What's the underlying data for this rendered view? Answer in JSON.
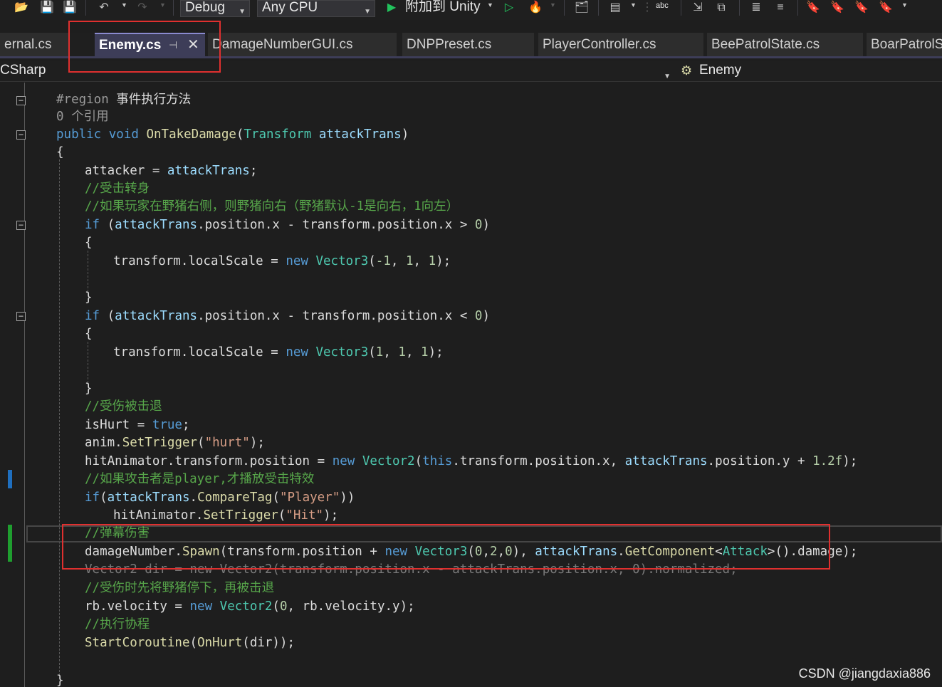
{
  "toolbar": {
    "config_value": "Debug",
    "platform_value": "Any CPU",
    "attach_label": "附加到 Unity",
    "spell_label": "abc"
  },
  "tabs": [
    {
      "label": "ernal.cs"
    },
    {
      "label": "Enemy.cs",
      "active": true
    },
    {
      "label": "DamageNumberGUI.cs"
    },
    {
      "label": "DNPPreset.cs"
    },
    {
      "label": "PlayerController.cs"
    },
    {
      "label": "BeePatrolState.cs"
    },
    {
      "label": "BoarPatrolS"
    }
  ],
  "navbar": {
    "project": "CSharp",
    "type_member": "Enemy"
  },
  "code": {
    "lines": [
      {
        "indent": 0,
        "tokens": [
          {
            "t": "#region",
            "c": "pp"
          },
          {
            "t": " 事件执行方法",
            "c": "plain"
          }
        ]
      },
      {
        "indent": 0,
        "tokens": [
          {
            "t": "0 个引用",
            "c": "ref"
          }
        ]
      },
      {
        "indent": 0,
        "tokens": [
          {
            "t": "public",
            "c": "kw"
          },
          {
            "t": " ",
            "c": "plain"
          },
          {
            "t": "void",
            "c": "kw"
          },
          {
            "t": " ",
            "c": "plain"
          },
          {
            "t": "OnTakeDamage",
            "c": "method"
          },
          {
            "t": "(",
            "c": "plain"
          },
          {
            "t": "Transform",
            "c": "type"
          },
          {
            "t": " ",
            "c": "plain"
          },
          {
            "t": "attackTrans",
            "c": "var"
          },
          {
            "t": ")",
            "c": "plain"
          }
        ]
      },
      {
        "indent": 0,
        "tokens": [
          {
            "t": "{",
            "c": "plain"
          }
        ]
      },
      {
        "indent": 1,
        "tokens": [
          {
            "t": "attacker",
            "c": "plain"
          },
          {
            "t": " = ",
            "c": "plain"
          },
          {
            "t": "attackTrans",
            "c": "var"
          },
          {
            "t": ";",
            "c": "plain"
          }
        ]
      },
      {
        "indent": 1,
        "tokens": [
          {
            "t": "//受击转身",
            "c": "cmt"
          }
        ]
      },
      {
        "indent": 1,
        "tokens": [
          {
            "t": "//如果玩家在野猪右侧，则野猪向右（野猪默认-1是向右，1向左）",
            "c": "cmt"
          }
        ]
      },
      {
        "indent": 1,
        "tokens": [
          {
            "t": "if",
            "c": "kw"
          },
          {
            "t": " (",
            "c": "plain"
          },
          {
            "t": "attackTrans",
            "c": "var"
          },
          {
            "t": ".position.x - transform.position.x > ",
            "c": "plain"
          },
          {
            "t": "0",
            "c": "num"
          },
          {
            "t": ")",
            "c": "plain"
          }
        ]
      },
      {
        "indent": 1,
        "tokens": [
          {
            "t": "{",
            "c": "plain"
          }
        ]
      },
      {
        "indent": 2,
        "tokens": [
          {
            "t": "transform.localScale = ",
            "c": "plain"
          },
          {
            "t": "new",
            "c": "kw"
          },
          {
            "t": " ",
            "c": "plain"
          },
          {
            "t": "Vector3",
            "c": "type"
          },
          {
            "t": "(",
            "c": "plain"
          },
          {
            "t": "-1",
            "c": "num"
          },
          {
            "t": ", ",
            "c": "plain"
          },
          {
            "t": "1",
            "c": "num"
          },
          {
            "t": ", ",
            "c": "plain"
          },
          {
            "t": "1",
            "c": "num"
          },
          {
            "t": ");",
            "c": "plain"
          }
        ]
      },
      {
        "indent": 2,
        "tokens": []
      },
      {
        "indent": 1,
        "tokens": [
          {
            "t": "}",
            "c": "plain"
          }
        ]
      },
      {
        "indent": 1,
        "tokens": [
          {
            "t": "if",
            "c": "kw"
          },
          {
            "t": " (",
            "c": "plain"
          },
          {
            "t": "attackTrans",
            "c": "var"
          },
          {
            "t": ".position.x - transform.position.x < ",
            "c": "plain"
          },
          {
            "t": "0",
            "c": "num"
          },
          {
            "t": ")",
            "c": "plain"
          }
        ]
      },
      {
        "indent": 1,
        "tokens": [
          {
            "t": "{",
            "c": "plain"
          }
        ]
      },
      {
        "indent": 2,
        "tokens": [
          {
            "t": "transform.localScale = ",
            "c": "plain"
          },
          {
            "t": "new",
            "c": "kw"
          },
          {
            "t": " ",
            "c": "plain"
          },
          {
            "t": "Vector3",
            "c": "type"
          },
          {
            "t": "(",
            "c": "plain"
          },
          {
            "t": "1",
            "c": "num"
          },
          {
            "t": ", ",
            "c": "plain"
          },
          {
            "t": "1",
            "c": "num"
          },
          {
            "t": ", ",
            "c": "plain"
          },
          {
            "t": "1",
            "c": "num"
          },
          {
            "t": ");",
            "c": "plain"
          }
        ]
      },
      {
        "indent": 2,
        "tokens": []
      },
      {
        "indent": 1,
        "tokens": [
          {
            "t": "}",
            "c": "plain"
          }
        ]
      },
      {
        "indent": 1,
        "tokens": [
          {
            "t": "//受伤被击退",
            "c": "cmt"
          }
        ]
      },
      {
        "indent": 1,
        "tokens": [
          {
            "t": "isHurt = ",
            "c": "plain"
          },
          {
            "t": "true",
            "c": "kw"
          },
          {
            "t": ";",
            "c": "plain"
          }
        ]
      },
      {
        "indent": 1,
        "tokens": [
          {
            "t": "anim.",
            "c": "plain"
          },
          {
            "t": "SetTrigger",
            "c": "method"
          },
          {
            "t": "(",
            "c": "plain"
          },
          {
            "t": "\"hurt\"",
            "c": "str"
          },
          {
            "t": ");",
            "c": "plain"
          }
        ]
      },
      {
        "indent": 1,
        "tokens": [
          {
            "t": "hitAnimator.transform.position = ",
            "c": "plain"
          },
          {
            "t": "new",
            "c": "kw"
          },
          {
            "t": " ",
            "c": "plain"
          },
          {
            "t": "Vector2",
            "c": "type"
          },
          {
            "t": "(",
            "c": "plain"
          },
          {
            "t": "this",
            "c": "kw"
          },
          {
            "t": ".transform.position.x, ",
            "c": "plain"
          },
          {
            "t": "attackTrans",
            "c": "var"
          },
          {
            "t": ".position.y + ",
            "c": "plain"
          },
          {
            "t": "1.2f",
            "c": "num"
          },
          {
            "t": ");",
            "c": "plain"
          }
        ]
      },
      {
        "indent": 1,
        "tokens": [
          {
            "t": "//如果攻击者是player,才播放受击特效",
            "c": "cmt"
          }
        ]
      },
      {
        "indent": 1,
        "tokens": [
          {
            "t": "if",
            "c": "kw"
          },
          {
            "t": "(",
            "c": "plain"
          },
          {
            "t": "attackTrans",
            "c": "var"
          },
          {
            "t": ".",
            "c": "plain"
          },
          {
            "t": "CompareTag",
            "c": "method"
          },
          {
            "t": "(",
            "c": "plain"
          },
          {
            "t": "\"Player\"",
            "c": "str"
          },
          {
            "t": "))",
            "c": "plain"
          }
        ]
      },
      {
        "indent": 2,
        "tokens": [
          {
            "t": "hitAnimator.",
            "c": "plain"
          },
          {
            "t": "SetTrigger",
            "c": "method"
          },
          {
            "t": "(",
            "c": "plain"
          },
          {
            "t": "\"Hit\"",
            "c": "str"
          },
          {
            "t": ");",
            "c": "plain"
          }
        ]
      },
      {
        "indent": 1,
        "tokens": [
          {
            "t": "//弹幕伤害",
            "c": "cmt"
          }
        ]
      },
      {
        "indent": 1,
        "tokens": [
          {
            "t": "damageNumber.",
            "c": "plain"
          },
          {
            "t": "Spawn",
            "c": "method"
          },
          {
            "t": "(transform.position + ",
            "c": "plain"
          },
          {
            "t": "new",
            "c": "kw"
          },
          {
            "t": " ",
            "c": "plain"
          },
          {
            "t": "Vector3",
            "c": "type"
          },
          {
            "t": "(",
            "c": "plain"
          },
          {
            "t": "0",
            "c": "num"
          },
          {
            "t": ",",
            "c": "plain"
          },
          {
            "t": "2",
            "c": "num"
          },
          {
            "t": ",",
            "c": "plain"
          },
          {
            "t": "0",
            "c": "num"
          },
          {
            "t": "), ",
            "c": "plain"
          },
          {
            "t": "attackTrans",
            "c": "var"
          },
          {
            "t": ".",
            "c": "plain"
          },
          {
            "t": "GetComponent",
            "c": "method"
          },
          {
            "t": "<",
            "c": "plain"
          },
          {
            "t": "Attack",
            "c": "type"
          },
          {
            "t": ">().damage);",
            "c": "plain"
          }
        ]
      },
      {
        "indent": 1,
        "tokens": [
          {
            "t": "Vector2 dir = new Vector2(transform.position.x - attackTrans.position.x, 0).normalized;",
            "c": "ghost"
          }
        ]
      },
      {
        "indent": 1,
        "tokens": [
          {
            "t": "//受伤时先将野猪停下，再被击退",
            "c": "cmt"
          }
        ]
      },
      {
        "indent": 1,
        "tokens": [
          {
            "t": "rb.velocity = ",
            "c": "plain"
          },
          {
            "t": "new",
            "c": "kw"
          },
          {
            "t": " ",
            "c": "plain"
          },
          {
            "t": "Vector2",
            "c": "type"
          },
          {
            "t": "(",
            "c": "plain"
          },
          {
            "t": "0",
            "c": "num"
          },
          {
            "t": ", rb.velocity.y);",
            "c": "plain"
          }
        ]
      },
      {
        "indent": 1,
        "tokens": [
          {
            "t": "//执行协程",
            "c": "cmt"
          }
        ]
      },
      {
        "indent": 1,
        "tokens": [
          {
            "t": "StartCoroutine",
            "c": "method"
          },
          {
            "t": "(",
            "c": "plain"
          },
          {
            "t": "OnHurt",
            "c": "method"
          },
          {
            "t": "(dir));",
            "c": "plain"
          }
        ]
      },
      {
        "indent": 1,
        "tokens": []
      },
      {
        "indent": 0,
        "tokens": [
          {
            "t": "}",
            "c": "plain"
          }
        ]
      }
    ]
  },
  "watermark": "CSDN @jiangdaxia886",
  "colors": {
    "keyword": "#569cd6",
    "type": "#4ec9b0",
    "method": "#dcdcaa",
    "string": "#d69d85",
    "comment": "#57a64a",
    "number": "#b5cea8",
    "variable": "#9cdcfe",
    "highlight_box": "#e0302f",
    "active_tab": "#3d3d58"
  }
}
